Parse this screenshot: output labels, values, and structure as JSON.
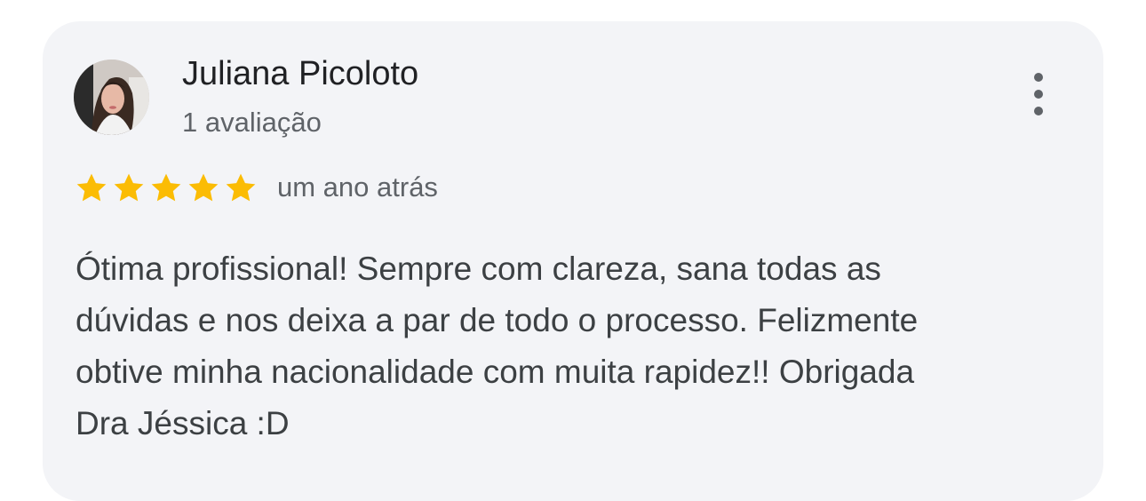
{
  "reviewer": {
    "name": "Juliana Picoloto",
    "review_count": "1 avaliação",
    "avatar_icon": "user-photo"
  },
  "menu": {
    "icon": "more-vert-icon"
  },
  "rating": {
    "stars": 5,
    "max_stars": 5,
    "star_color": "#fbbc04",
    "time": "um ano atrás"
  },
  "review": {
    "lines": [
      "Ótima profissional! Sempre com clareza, sana todas as",
      "dúvidas e nos deixa a par de todo o processo. Felizmente",
      "obtive minha nacionalidade com muita rapidez!! Obrigada",
      "Dra Jéssica :D"
    ]
  },
  "colors": {
    "card_background": "#f3f4f7",
    "name_text": "#202124",
    "secondary_text": "#5f6368",
    "body_text": "#3c4043"
  }
}
